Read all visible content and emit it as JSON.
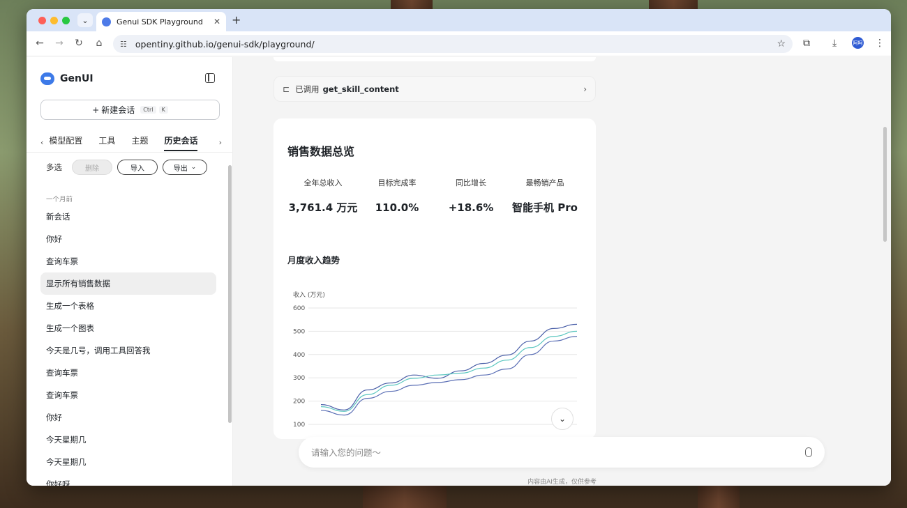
{
  "browser": {
    "tab_title": "Genui SDK Playground",
    "url": "opentiny.github.io/genui-sdk/playground/",
    "avatar_text": "阿呵"
  },
  "sidebar": {
    "brand": "GenUI",
    "new_chat_label": "新建会话",
    "shortcut_ctrl": "Ctrl",
    "shortcut_key": "K",
    "tabs": [
      {
        "label": "模型配置",
        "active": false
      },
      {
        "label": "工具",
        "active": false
      },
      {
        "label": "主题",
        "active": false
      },
      {
        "label": "历史会话",
        "active": true
      }
    ],
    "multi_select": "多选",
    "delete_label": "删除",
    "import_label": "导入",
    "export_label": "导出",
    "group_label": "一个月前",
    "history": [
      "新会话",
      "你好",
      "查询车票",
      "显示所有销售数据",
      "生成一个表格",
      "生成一个图表",
      "今天是几号，调用工具回答我",
      "查询车票",
      "查询车票",
      "你好",
      "今天星期几",
      "今天星期几",
      "你好呀"
    ],
    "active_history_index": 3
  },
  "main": {
    "tool_call_prefix": "已调用",
    "tool_call_name": "get_skill_content",
    "card_title": "销售数据总览",
    "kpis": [
      {
        "label": "全年总收入",
        "value": "3,761.4 万元"
      },
      {
        "label": "目标完成率",
        "value": "110.0%"
      },
      {
        "label": "同比增长",
        "value": "+18.6%"
      },
      {
        "label": "最畅销产品",
        "value": "智能手机 Pro"
      }
    ],
    "section_title": "月度收入趋势",
    "input_placeholder": "请输入您的问题～",
    "disclaimer": "内容由AI生成，仅供参考"
  },
  "chart_data": {
    "type": "line",
    "ylabel": "收入 (万元)",
    "ylim": [
      100,
      600
    ],
    "yticks": [
      600,
      500,
      400,
      300,
      200,
      100
    ],
    "grid": true,
    "x": [
      1,
      2,
      3,
      4,
      5,
      6,
      7,
      8,
      9,
      10,
      11,
      12
    ],
    "series": [
      {
        "color": "#4a5fa8",
        "values": [
          185,
          162,
          248,
          278,
          312,
          298,
          330,
          362,
          398,
          458,
          512,
          530
        ]
      },
      {
        "color": "#5cc7c0",
        "values": [
          176,
          156,
          228,
          268,
          298,
          312,
          320,
          342,
          376,
          430,
          478,
          500
        ]
      },
      {
        "color": "#5b6fb5",
        "values": [
          160,
          140,
          212,
          242,
          268,
          280,
          292,
          312,
          338,
          400,
          458,
          478
        ]
      }
    ]
  }
}
